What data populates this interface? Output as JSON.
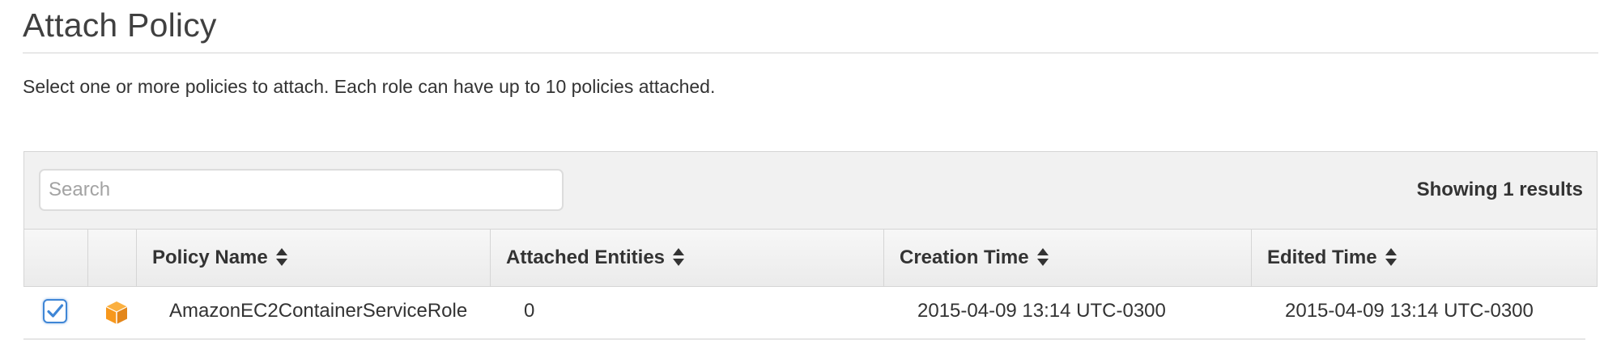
{
  "page": {
    "title": "Attach Policy",
    "subtitle": "Select one or more policies to attach. Each role can have up to 10 policies attached."
  },
  "toolbar": {
    "search_placeholder": "Search",
    "results_text": "Showing 1 results"
  },
  "table": {
    "columns": [
      {
        "label": "",
        "sortable": false
      },
      {
        "label": "",
        "sortable": false
      },
      {
        "label": "Policy Name",
        "sortable": true
      },
      {
        "label": "Attached Entities",
        "sortable": true
      },
      {
        "label": "Creation Time",
        "sortable": true
      },
      {
        "label": "Edited Time",
        "sortable": true
      }
    ],
    "rows": [
      {
        "checked": true,
        "icon": "aws-managed-policy-cube-icon",
        "policy_name": "AmazonEC2ContainerServiceRole",
        "attached_entities": "0",
        "creation_time": "2015-04-09 13:14 UTC-0300",
        "edited_time": "2015-04-09 13:14 UTC-0300"
      }
    ]
  },
  "colors": {
    "checkbox_accent": "#3f86d6",
    "policy_icon": "#f7981d",
    "header_bg": "#f1f1f1",
    "text": "#333333"
  }
}
